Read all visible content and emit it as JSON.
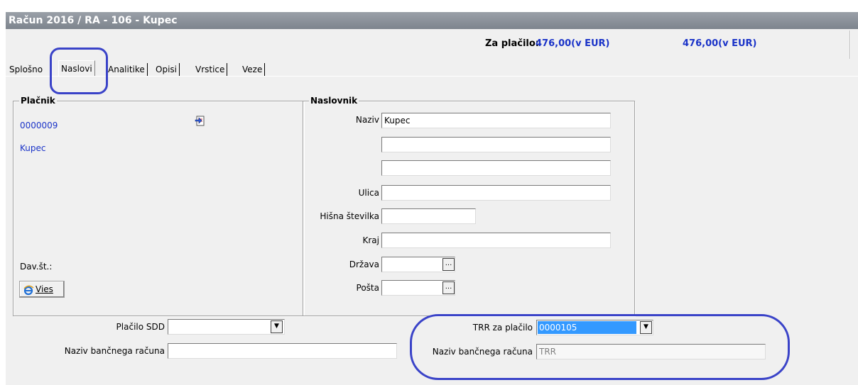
{
  "window": {
    "title": "Račun  2016 / RA - 106 - Kupec"
  },
  "header": {
    "pay_label": "Za plačilo:",
    "pay_value_1": "476,00(v EUR)",
    "pay_value_2": "476,00(v EUR)"
  },
  "tabs": [
    {
      "label": "Splošno"
    },
    {
      "label": "Naslovi",
      "active": true
    },
    {
      "label": "Analitike"
    },
    {
      "label": "Opisi"
    },
    {
      "label": "Vrstice"
    },
    {
      "label": "Veze"
    }
  ],
  "payer": {
    "title": "Plačnik",
    "code": "0000009",
    "name": "Kupec",
    "vat_label": "Dav.št.:",
    "vies_button": "Vies",
    "edit_icon": "edit-document-icon",
    "vies_icon": "ie-globe-icon"
  },
  "addressee": {
    "title": "Naslovnik",
    "naziv_label": "Naziv",
    "naziv_value": "Kupec",
    "line2_value": "",
    "line3_value": "",
    "ulica_label": "Ulica",
    "ulica_value": "",
    "hisna_label": "Hišna številka",
    "hisna_value": "",
    "kraj_label": "Kraj",
    "kraj_value": "",
    "drzava_label": "Država",
    "drzava_value": "",
    "posta_label": "Pošta",
    "posta_value": "",
    "browse_label": "..."
  },
  "payment": {
    "sdd_label": "Plačilo SDD",
    "sdd_value": "",
    "bank_name_label_left": "Naziv bančnega računa",
    "bank_name_value_left": "",
    "trr_label": "TRR za plačilo",
    "trr_value": "0000105",
    "bank_name_label_right": "Naziv bančnega računa",
    "bank_name_value_right": "TRR"
  },
  "colors": {
    "accent": "#1a33c8",
    "highlight": "#3399ff",
    "ring": "#3a43c8"
  }
}
